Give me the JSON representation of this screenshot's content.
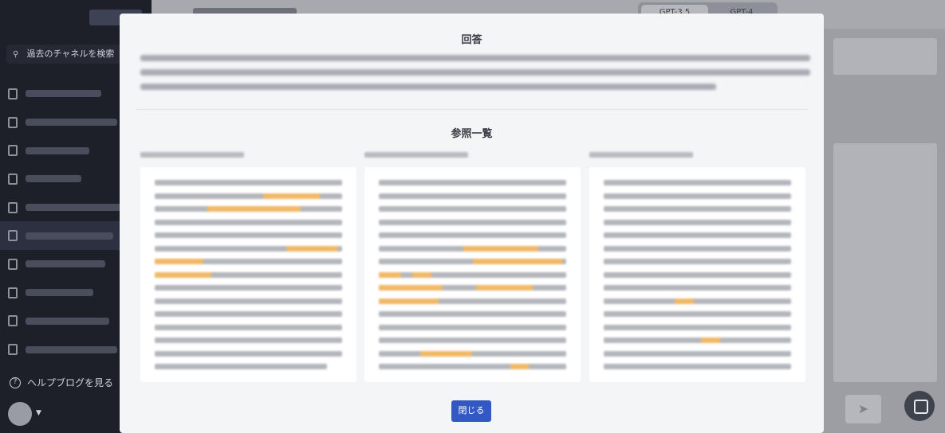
{
  "sidebar": {
    "search_label": "過去のチャネルを検索",
    "help_label": "ヘルプブログを見る"
  },
  "header": {
    "model_tabs": [
      "GPT-3.5",
      "GPT-4"
    ]
  },
  "modal": {
    "title": "回答",
    "references_title": "参照一覧",
    "close_label": "閉じる"
  },
  "colors": {
    "accent": "#3358c4",
    "highlight": "#f0b866",
    "sidebar_bg": "#1d1f29"
  }
}
